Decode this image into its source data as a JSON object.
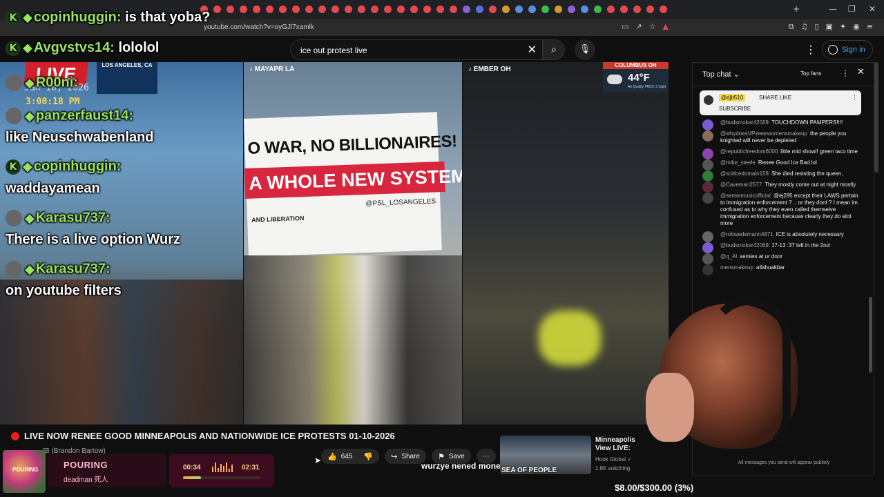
{
  "browser": {
    "url": "youtube.com/watch?v=oyGJl7xamlk",
    "tab_colors": [
      "#e5484d",
      "#e5484d",
      "#e5484d",
      "#e5484d",
      "#e5484d",
      "#e5484d",
      "#e5484d",
      "#e5484d",
      "#e5484d",
      "#e5484d",
      "#e5484d",
      "#e5484d",
      "#e5484d",
      "#e5484d",
      "#e5484d",
      "#e5484d",
      "#e5484d",
      "#e5484d",
      "#e5484d",
      "#e5484d",
      "#8a63d2",
      "#5b6ee1",
      "#e5484d",
      "#d29a2a",
      "#5b8ee1",
      "#5b8ee1",
      "#3fb950",
      "#d29a2a",
      "#8a63d2",
      "#5b8ee1",
      "#3fb950",
      "#e5484d",
      "#e5484d",
      "#e5484d",
      "#e5484d",
      "#e5484d"
    ],
    "new_tab": "+",
    "minimize": "—",
    "maximize": "❐",
    "close": "✕"
  },
  "youtube": {
    "search_value": "ice out protest live",
    "search_clear": "✕",
    "search_icon": "⌕",
    "mic_icon": "🎙",
    "more_icon": "⋮",
    "sign_in": "Sign in"
  },
  "overlay": {
    "live_logo": "LIVE",
    "date": "Jan 10, 2026",
    "time": "3:00:18 PM",
    "la_city": "LOS ANGELES, CA",
    "messages": [
      {
        "user": "copinhuggin:",
        "text": "is that yoba?"
      },
      {
        "user": "Avgvstvs14:",
        "text": "lololol"
      },
      {
        "user": "R00ni:",
        "text": ""
      },
      {
        "user": "panzerfaust14:",
        "text": "like Neuschwabenland"
      },
      {
        "user": "copinhuggin:",
        "text": "waddayamean"
      },
      {
        "user": "Karasu737:",
        "text": "There is a live option Wurz"
      },
      {
        "user": "Karasu737:",
        "text": "on youtube filters"
      }
    ]
  },
  "streams": [
    {
      "tag": "♪ MAYAPR LA"
    },
    {
      "tag": "♪ EMBER OH"
    }
  ],
  "banner": {
    "line1": "O WAR, NO BILLIONAIRES!",
    "line2": "A WHOLE NEW SYSTEM!",
    "line3": "@PSL_LOSANGELES",
    "line4": "AND LIBERATION"
  },
  "weather": {
    "city": "COLUMBUS OH",
    "temp": "44°F",
    "air": "Air Quality PM10: 3 Light"
  },
  "video": {
    "title": "LIVE NOW RENEE GOOD MINNEAPOLIS AND NATIONWIDE ICE PROTESTS 01-10-2026",
    "channel": "JB (Brandon Bartow)",
    "likes": "645",
    "share": "Share",
    "save": "Save",
    "more": "⋯",
    "subtitle": "wurzye nened money"
  },
  "music": {
    "album_text": "POURING",
    "song": "POURING",
    "artist": "deadman 死人",
    "current": "00:34",
    "total": "02:31",
    "progress": 0.23
  },
  "recommended": {
    "title_line1": "Minneapolis",
    "title_line2": "View LIVE:",
    "channel": "Hook Global ✓",
    "watching": "1.8K watching",
    "thumb_text": "SEA OF PEOPLE"
  },
  "goal": "$8.00/$300.00 (3%)",
  "chat": {
    "header": "Top chat ⌄",
    "top_fans": "Top fans",
    "pinned_user": "@djb510",
    "pinned_msg": "SHARE LIKE",
    "pinned_msg2": "SUBSCRIBE",
    "messages": [
      {
        "user": "@budsmoker42069",
        "text": "TOUCHDOWN PAMPERS!!!!",
        "color": "#7a5bd1"
      },
      {
        "user": "@whydoesVPwearwomensmakeup",
        "text": "the people you knighted will never be depleted",
        "color": "#8a6a5a"
      },
      {
        "user": "@republicfreedom6000",
        "text": "little mid showl! green taco time",
        "color": "#8e44ad"
      },
      {
        "user": "@mike_steele",
        "text": "Renee Good Ice Bad lol",
        "color": "#555555"
      },
      {
        "user": "@scitlcedomain159",
        "text": "She died resisting the queen,",
        "color": "#2e7d32"
      },
      {
        "user": "@Caveman2577",
        "text": "They mostly come out at night mostly",
        "color": "#5a2a3a"
      },
      {
        "user": "@sensemusicofficial",
        "text": "@ej295 except their LAWS pertain to immigration enforcement ? .. or they dont ? I mean im confused as to why they even called themselve immigration enforcement because clearly they do alot more",
        "color": "#444444"
      },
      {
        "user": "@robwedemann4871",
        "text": "ICE is absolutely necessary",
        "color": "#666666"
      },
      {
        "user": "@budsmoker42069",
        "text": "17-13 :37 left in the 2nd",
        "color": "#7a5bd1"
      },
      {
        "user": "@q_Al",
        "text": "semies at ur door",
        "color": "#555555"
      },
      {
        "user": "mensmakeup",
        "text": "allahuakbar",
        "color": "#333333"
      }
    ],
    "footer": "All messages you send will appear publicly"
  }
}
